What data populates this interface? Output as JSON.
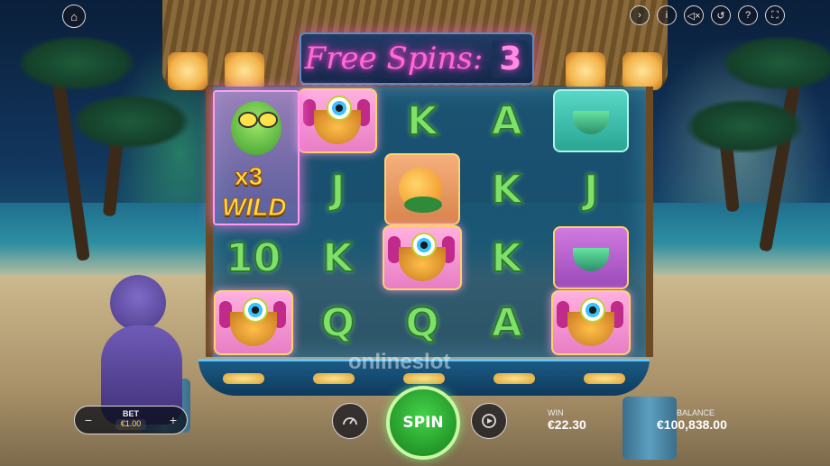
{
  "title": {
    "free_spins_label": "Free Spins:",
    "free_spins_count": "3"
  },
  "reels": {
    "wild": {
      "multiplier": "x3",
      "label": "WILD"
    },
    "grid": [
      [
        "wild",
        "eyeball-bowl",
        "K",
        "A",
        "teal-drink"
      ],
      [
        "wild",
        "J",
        "fish",
        "K",
        "J"
      ],
      [
        "10",
        "K",
        "eyeball-bowl",
        "K",
        "purple-drink"
      ],
      [
        "eyeball-bowl",
        "Q",
        "Q",
        "A",
        "eyeball-bowl"
      ]
    ]
  },
  "watermark": "onlineslot",
  "top_bar": {
    "icons": [
      "chevron-right-icon",
      "info-icon",
      "sound-off-icon",
      "history-icon",
      "help-icon",
      "fullscreen-icon"
    ]
  },
  "bet": {
    "label": "BET",
    "value": "€1.00",
    "minus": "−",
    "plus": "+"
  },
  "spin": {
    "label": "SPIN"
  },
  "win": {
    "label": "WIN",
    "value": "€22.30"
  },
  "balance": {
    "label": "BALANCE",
    "value": "€100,838.00"
  },
  "colors": {
    "spin_green": "#2fae35",
    "title_pink": "#ff6ad5",
    "wild_gold": "#ffd84a",
    "bet_value": "#ffe066"
  }
}
